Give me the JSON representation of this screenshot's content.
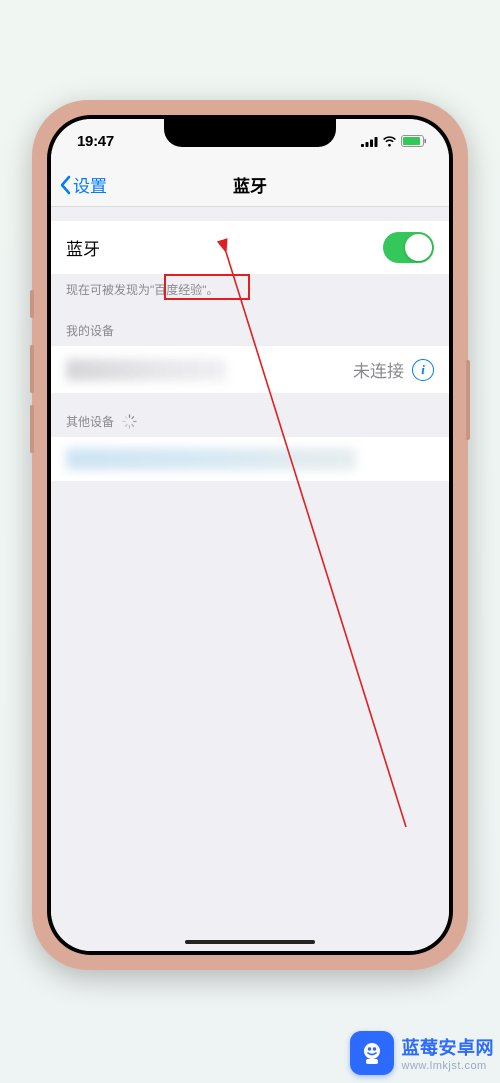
{
  "statusbar": {
    "time": "19:47"
  },
  "nav": {
    "back_label": "设置",
    "title": "蓝牙"
  },
  "bluetooth": {
    "label": "蓝牙",
    "toggle_on": true,
    "discoverable_text": "现在可被发现为\"百度经验\"。"
  },
  "my_devices": {
    "header": "我的设备",
    "status": "未连接"
  },
  "other_devices": {
    "header": "其他设备"
  },
  "watermark": {
    "title": "蓝莓安卓网",
    "url": "www.lmkjst.com"
  }
}
